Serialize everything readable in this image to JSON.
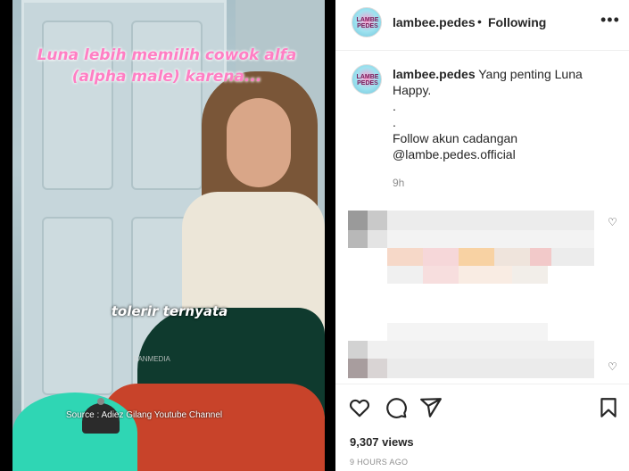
{
  "video": {
    "caption_top": "Luna lebih memilih cowok alfa (alpha male) karena...",
    "caption_mid": "tolerir ternyata",
    "watermark": "FANMEDIA",
    "source": "Source : Adiez Gilang Youtube Channel"
  },
  "header": {
    "username": "lambee.pedes",
    "separator": "•",
    "follow_label": "Following",
    "more_icon": "more-horizontal-icon",
    "avatar_text": "LAMBE PEDES"
  },
  "caption": {
    "username": "lambee.pedes",
    "text_line1": "Yang penting Luna",
    "text_line2": "Happy.",
    "dot1": ".",
    "dot2": ".",
    "text_line3": "Follow akun cadangan",
    "mention": "@lambe.pedes.official",
    "time": "9h"
  },
  "actions": {
    "like_icon": "heart-icon",
    "comment_icon": "comment-icon",
    "share_icon": "send-icon",
    "save_icon": "bookmark-icon"
  },
  "stats": {
    "views": "9,307 views",
    "posted": "9 HOURS AGO"
  },
  "colors": {
    "caption_pink": "#ff7fc4",
    "text": "#262626",
    "muted": "#8e8e8e"
  }
}
